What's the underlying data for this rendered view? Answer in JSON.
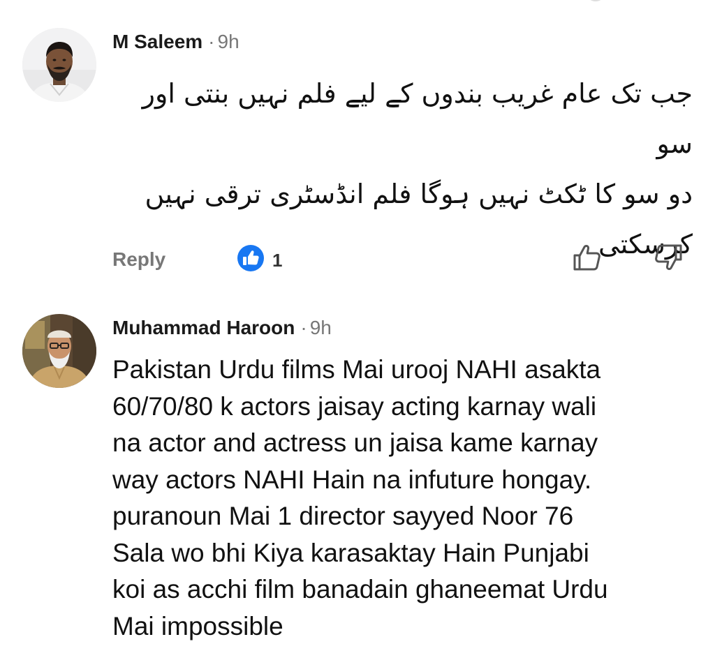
{
  "comments": [
    {
      "author": "M Saleem",
      "separator": "·",
      "time": "9h",
      "avatar": "avatar-man-beard",
      "lines": [
        "جب تک عام غریب بندوں کے لیے فلم نہیں بنتی اور سو",
        "دو سو کا ٹکٹ نہیں ہوگا فلم انڈسٹری ترقی نہیں",
        "کرسکتی"
      ],
      "actions": {
        "reply_label": "Reply",
        "like_count": "1",
        "like_icon": "thumbs-up-filled-blue",
        "upvote_icon": "thumbs-up-outline",
        "downvote_icon": "thumbs-down-outline"
      }
    },
    {
      "author": "Muhammad Haroon",
      "separator": "·",
      "time": "9h",
      "avatar": "avatar-elder-cap",
      "lines": [
        "Pakistan Urdu films Mai urooj NAHI asakta",
        "60/70/80 k actors jaisay acting karnay wali",
        "na actor and actress un jaisa kame karnay",
        "way actors NAHI Hain na infuture hongay.",
        "puranoun Mai 1 director sayyed Noor 76",
        "Sala wo bhi Kiya karasaktay Hain Punjabi",
        "koi as acchi film banadain ghaneemat Urdu",
        "Mai impossible"
      ]
    }
  ],
  "colors": {
    "author": "#1a1a1a",
    "meta": "#777777",
    "body": "#111111",
    "like_badge": "#1877f2",
    "icon_stroke": "#555555"
  }
}
